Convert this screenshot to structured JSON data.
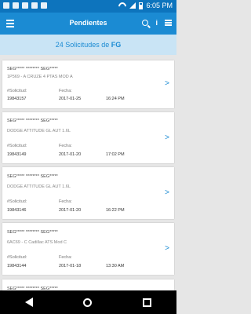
{
  "status_bar": {
    "time": "6:05 PM"
  },
  "app_bar": {
    "title": "Pendientes",
    "info_label": "i"
  },
  "subheader": {
    "text": "24 Solicitudes de ",
    "highlight": "FG"
  },
  "labels": {
    "request": "#Solicitud:",
    "date": "Fecha:"
  },
  "cards": [
    {
      "name": "SEG***** ******** SEG*****",
      "vehicle": "1P569 - A CRUZE 4 PTAS MOD A",
      "request": "19843157",
      "date": "2017-01-25",
      "time": "16:24 PM"
    },
    {
      "name": "SEG***** ******** SEG*****",
      "vehicle": "DODGE ATTITUDE GL AUT 1.6L",
      "request": "19843149",
      "date": "2017-01-20",
      "time": "17:02 PM"
    },
    {
      "name": "SEG***** ******** SEG*****",
      "vehicle": "DODGE ATTITUDE GL AUT 1.6L",
      "request": "19843146",
      "date": "2017-01-20",
      "time": "16:22 PM"
    },
    {
      "name": "SEG***** ******** SEG*****",
      "vehicle": "6AC69 - C Cadillac ATS Mod C",
      "request": "19843144",
      "date": "2017-01-18",
      "time": "13:30 AM"
    },
    {
      "name": "SEG***** ******** SEG*****"
    }
  ],
  "icons": [
    "menu-icon",
    "search-icon",
    "sliders-icon",
    "chevron-right-icon"
  ]
}
